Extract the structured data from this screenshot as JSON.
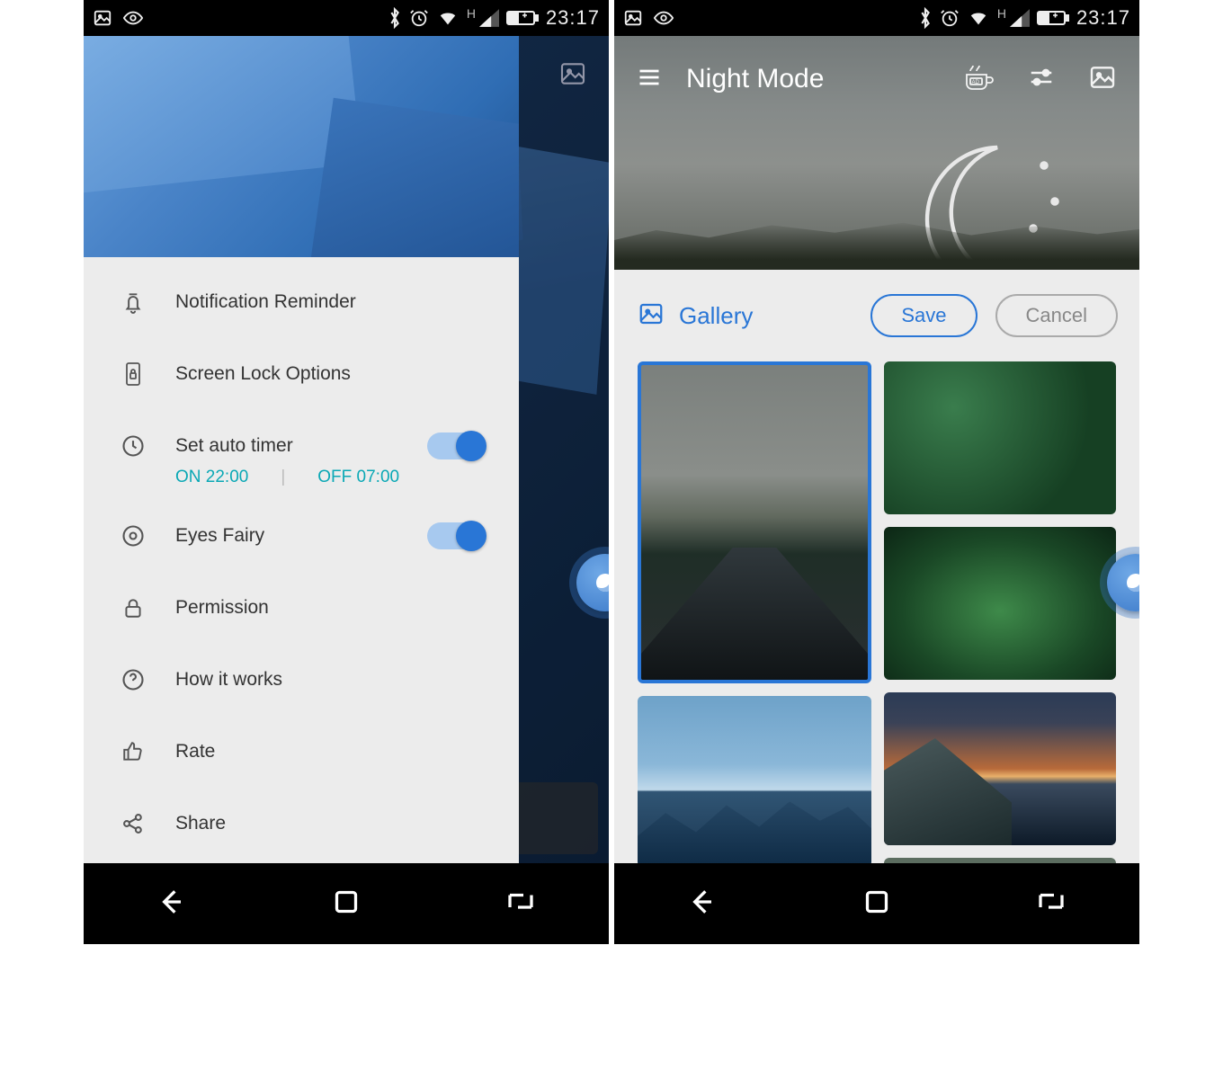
{
  "status": {
    "time": "23:17",
    "network_indicator": "H"
  },
  "phone1": {
    "drawer": {
      "items": [
        {
          "label": "Notification Reminder",
          "toggle": null
        },
        {
          "label": "Screen Lock Options",
          "toggle": null
        },
        {
          "label": "Set auto timer",
          "toggle": true
        },
        {
          "label": "Eyes Fairy",
          "toggle": true
        },
        {
          "label": "Permission",
          "toggle": null
        },
        {
          "label": "How it works",
          "toggle": null
        },
        {
          "label": "Rate",
          "toggle": null
        },
        {
          "label": "Share",
          "toggle": null
        }
      ],
      "timer": {
        "on_prefix": "ON ",
        "on_time": "22:00",
        "off_prefix": "OFF ",
        "off_time": "07:00"
      }
    }
  },
  "phone2": {
    "header": {
      "title": "Night Mode"
    },
    "toolbar": {
      "gallery_label": "Gallery",
      "save_label": "Save",
      "cancel_label": "Cancel"
    }
  }
}
